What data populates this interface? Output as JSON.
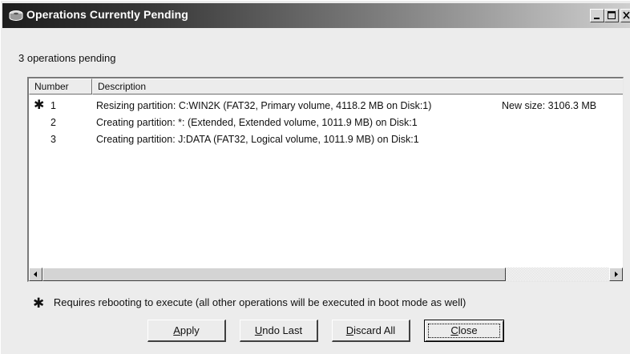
{
  "window": {
    "title": "Operations Currently Pending",
    "title_icon": "hard-disk-icon",
    "title_controls": [
      "minimize-icon",
      "maximize-icon",
      "close-icon"
    ]
  },
  "summary": "3 operations pending",
  "list": {
    "columns": [
      "Number",
      "Description"
    ],
    "rows": [
      {
        "marker": "✱",
        "number": "1",
        "description": "Resizing partition: C:WIN2K     (FAT32, Primary volume, 4118.2 MB on Disk:1)",
        "extra": "New size: 3106.3 MB"
      },
      {
        "marker": "",
        "number": "2",
        "description": "Creating partition: *:     (Extended, Extended volume, 1011.9 MB) on Disk:1",
        "extra": ""
      },
      {
        "marker": "",
        "number": "3",
        "description": "Creating partition: J:DATA     (FAT32, Logical volume, 1011.9 MB) on Disk:1",
        "extra": ""
      }
    ],
    "scrollbar": {
      "left_icon": "arrow-left-icon",
      "right_icon": "arrow-right-icon"
    }
  },
  "note": {
    "marker": "✱",
    "text": "Requires rebooting to execute (all other operations will be executed in boot mode as well)"
  },
  "buttons": {
    "apply": {
      "mnemonic": "A",
      "rest": "pply"
    },
    "undo_last": {
      "mnemonic": "U",
      "rest": "ndo Last"
    },
    "discard_all": {
      "mnemonic": "D",
      "rest": "iscard All"
    },
    "close": {
      "mnemonic": "C",
      "rest": "lose"
    }
  },
  "colors": {
    "face": "#ececec",
    "title_dark": "#1d1d1d",
    "title_light": "#cfcfcf"
  }
}
